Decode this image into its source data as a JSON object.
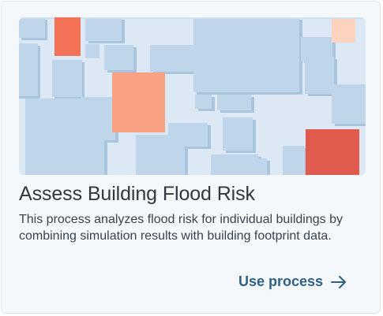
{
  "card": {
    "title": "Assess Building Flood Risk",
    "description": "This process analyzes flood risk for individual buildings by combining simulation results with building footprint data.",
    "action_label": "Use process",
    "action_icon": "arrow-right-icon",
    "thumbnail_icon": "building-footprint-map-icon"
  },
  "colors": {
    "card_background": "#f5f8fb",
    "card_border": "#dfe5ec",
    "map_background": "#dce9f4",
    "building": "#bfd6ea",
    "building_shadow": "#a9c5de",
    "risk_high": "#e05a4e",
    "risk_elevated": "#f47358",
    "risk_medium": "#f9a283",
    "risk_low": "#fbd3bf",
    "title": "#2f3740",
    "action": "#2e5f86"
  }
}
